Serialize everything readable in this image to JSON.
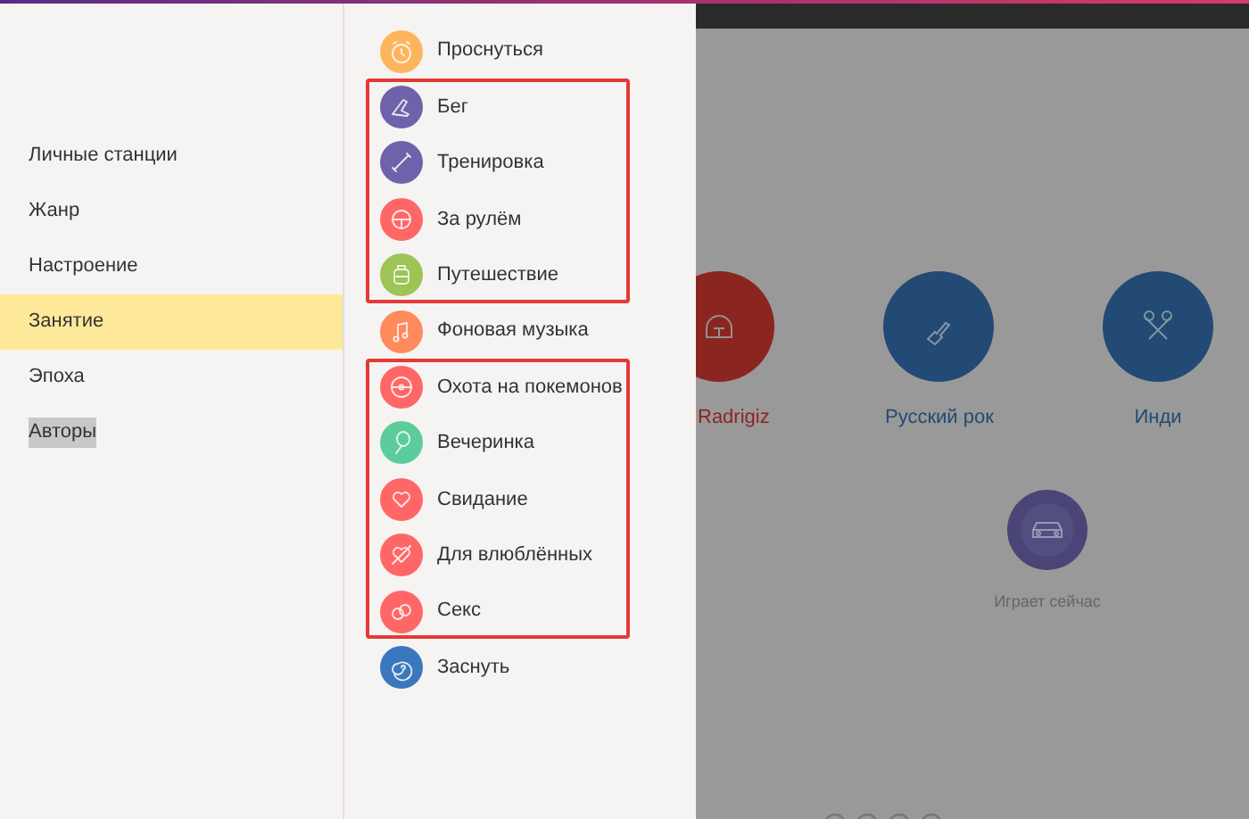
{
  "sidebar": {
    "items": [
      {
        "label": "Личные станции",
        "selected": false,
        "highlighted": false
      },
      {
        "label": "Жанр",
        "selected": false,
        "highlighted": false
      },
      {
        "label": "Настроение",
        "selected": false,
        "highlighted": false
      },
      {
        "label": "Занятие",
        "selected": true,
        "highlighted": false
      },
      {
        "label": "Эпоха",
        "selected": false,
        "highlighted": false
      },
      {
        "label": "Авторы",
        "selected": false,
        "highlighted": true
      }
    ]
  },
  "activities": {
    "groups": [
      {
        "outlined": false,
        "items": [
          {
            "label": "Проснуться",
            "color": "#fdb55d"
          }
        ]
      },
      {
        "outlined": true,
        "items": [
          {
            "label": "Бег",
            "color": "#6f62aa"
          },
          {
            "label": "Тренировка",
            "color": "#6f62aa"
          },
          {
            "label": "За рулём",
            "color": "#ff6767"
          },
          {
            "label": "Путешествие",
            "color": "#9dc455"
          }
        ]
      },
      {
        "outlined": false,
        "items": [
          {
            "label": "Фоновая музыка",
            "color": "#ff8a5c"
          }
        ]
      },
      {
        "outlined": true,
        "items": [
          {
            "label": "Охота на покемонов",
            "color": "#ff6767"
          },
          {
            "label": "Вечеринка",
            "color": "#5ccc9a"
          },
          {
            "label": "Свидание",
            "color": "#ff6767"
          },
          {
            "label": "Для влюблённых",
            "color": "#ff6767"
          },
          {
            "label": "Секс",
            "color": "#ff6767"
          }
        ]
      },
      {
        "outlined": false,
        "items": [
          {
            "label": "Заснуть",
            "color": "#3a78bd"
          }
        ]
      }
    ]
  },
  "stations": [
    {
      "label": "Radrigiz",
      "color": "#8b2520"
    },
    {
      "label": "Русский рок",
      "color": "#234a75"
    },
    {
      "label": "Инди",
      "color": "#234a75"
    }
  ],
  "now_playing": {
    "label": "Играет сейчас"
  }
}
